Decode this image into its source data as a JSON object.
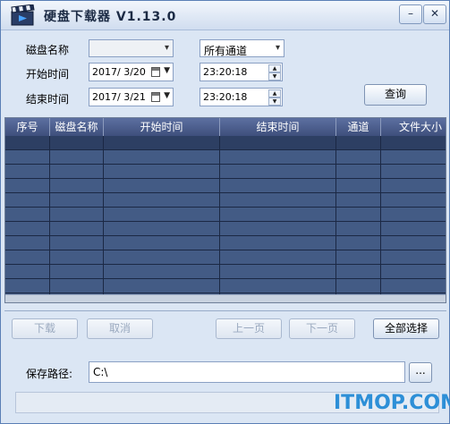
{
  "window": {
    "title": "硬盘下载器 V1.13.0",
    "controls": {
      "minimize": "–",
      "close": "✕"
    }
  },
  "filters": {
    "disk_label": "磁盘名称",
    "disk_value": "",
    "channel_value": "所有通道",
    "start_label": "开始时间",
    "start_date": "2017/ 3/20",
    "start_time": "23:20:18",
    "end_label": "结束时间",
    "end_date": "2017/ 3/21",
    "end_time": "23:20:18",
    "query_button": "查询"
  },
  "table": {
    "columns": [
      "序号",
      "磁盘名称",
      "开始时间",
      "结束时间",
      "通道",
      "文件大小"
    ],
    "rows": []
  },
  "actions": {
    "download": "下载",
    "cancel": "取消",
    "prev_page": "上一页",
    "next_page": "下一页",
    "select_all": "全部选择"
  },
  "save": {
    "label": "保存路径:",
    "path": "C:\\",
    "browse": "..."
  },
  "watermark": "ITMOP.COM"
}
